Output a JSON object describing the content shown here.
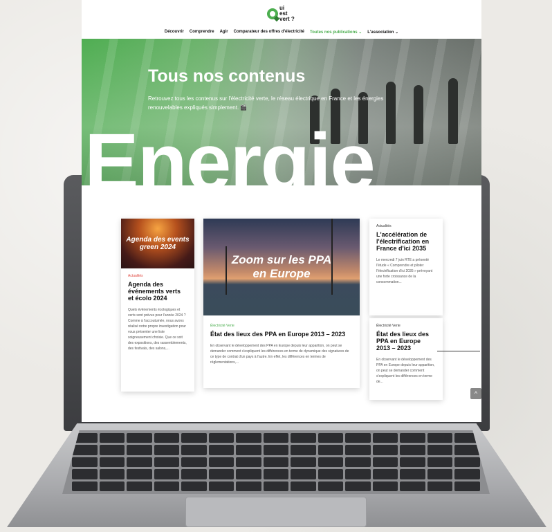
{
  "header": {
    "logo_text_1": "ui",
    "logo_text_2": "est",
    "logo_text_3": "vert ?",
    "nav": [
      {
        "label": "Découvrir"
      },
      {
        "label": "Comprendre"
      },
      {
        "label": "Agir"
      },
      {
        "label": "Comparateur des offres d'électricité"
      },
      {
        "label": "Toutes nos publications ⌄"
      },
      {
        "label": "L'association ⌄"
      }
    ]
  },
  "hero": {
    "title": "Tous nos contenus",
    "subtitle": "Retrouvez tous les contenus sur l'électricité verte, le réseau électrique en France et les énergies renouvelables expliqués simplement. 🎬",
    "big_word": "Energie"
  },
  "cards": [
    {
      "thumb_text": "Agenda des events green 2024",
      "category": "Actualités",
      "title": "Agenda des événements verts et écolo 2024",
      "text": "Quels événements écologiques et verts sont prévus pour l'année 2024 ? Comme à l'accoutumée, nous avons réalisé notre propre investigation pour vous présenter une liste soigneusement choisie. Que ce soit des expositions, des rassemblements, des festivals, des salons,..."
    },
    {
      "thumb_text": "Zoom sur les PPA en Europe",
      "category": "Électricité Verte",
      "title": "État des lieux des PPA en Europe 2013 – 2023",
      "text": "En observant le développement des PPA en Europe depuis leur apparition, on peut se demander comment s'expliquent les différences en terme de dynamique des signatures de ce type de contrat d'un pays à l'autre. En effet, les différences en termes de réglementations,..."
    },
    {
      "category": "Actualités",
      "title": "L'accélération de l'électrification en France d'ici 2035",
      "text": "Le mercredi 7 juin RTE a présenté l'étude « Comprendre et piloter l'électrification d'ici 2035 » prévoyant une forte croissance de la consommation..."
    },
    {
      "category": "Électricité Verte",
      "title": "État des lieux des PPA en Europe 2013 – 2023",
      "text": "En observant le développement des PPA en Europe depuis leur apparition, on peut se demander comment s'expliquent les différences en terme de..."
    }
  ],
  "scroll_top_label": "^",
  "colors": {
    "brand_green": "#4cae4f",
    "category_red": "#e0443c"
  }
}
